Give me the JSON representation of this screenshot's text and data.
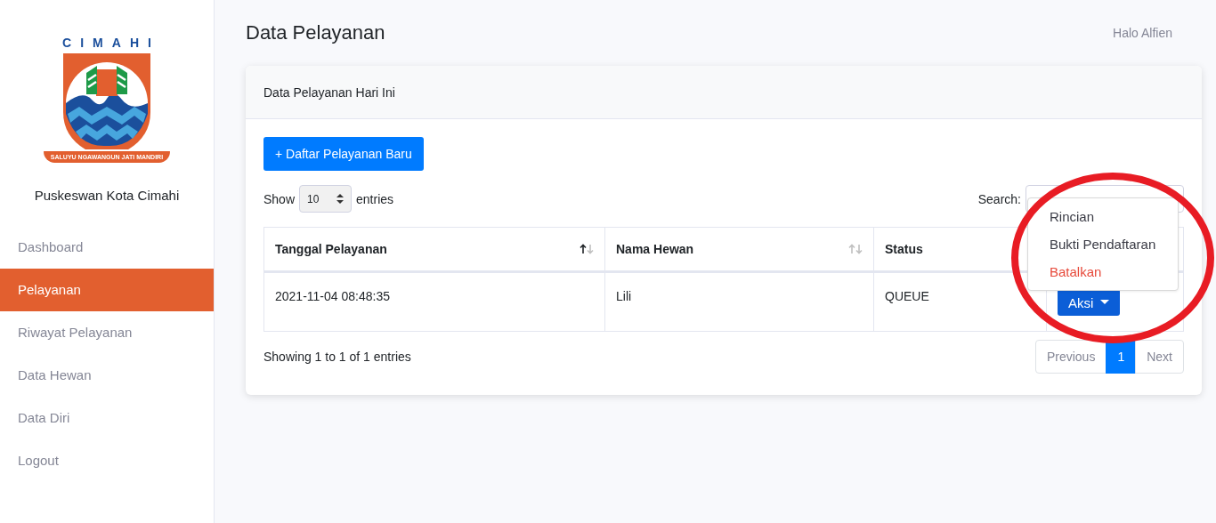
{
  "sidebar": {
    "logo": {
      "city": "CIMAHI",
      "motto": "SALUYU NGAWANGUN JATI MANDIRI"
    },
    "app_name": "Puskeswan Kota Cimahi",
    "items": [
      {
        "label": "Dashboard",
        "selected": false
      },
      {
        "label": "Pelayanan",
        "selected": true
      },
      {
        "label": "Riwayat Pelayanan",
        "selected": false
      },
      {
        "label": "Data Hewan",
        "selected": false
      },
      {
        "label": "Data Diri",
        "selected": false
      },
      {
        "label": "Logout",
        "selected": false
      }
    ]
  },
  "header": {
    "title": "Data Pelayanan",
    "greeting": "Halo Alfien"
  },
  "card": {
    "title": "Data Pelayanan Hari Ini",
    "add_button": "+ Daftar Pelayanan Baru",
    "length": {
      "before": "Show",
      "value": "10",
      "after": "entries"
    },
    "search": {
      "label": "Search:"
    },
    "table": {
      "columns": [
        {
          "label": "Tanggal Pelayanan",
          "sorted": true
        },
        {
          "label": "Nama Hewan",
          "sorted": false
        },
        {
          "label": "Status"
        }
      ],
      "rows": [
        {
          "date": "2021-11-04 08:48:35",
          "animal": "Lili",
          "status": "QUEUE",
          "action": "Aksi"
        }
      ]
    },
    "info": "Showing 1 to 1 of 1 entries",
    "pagination": [
      {
        "label": "Previous",
        "selected": false
      },
      {
        "label": "1",
        "selected": true
      },
      {
        "label": "Next",
        "selected": false
      }
    ],
    "dropdown": {
      "expanded": true,
      "items": [
        {
          "label": "Rincian",
          "kind": "normal"
        },
        {
          "label": "Bukti Pendaftaran",
          "kind": "normal"
        },
        {
          "label": "Batalkan",
          "kind": "danger"
        }
      ]
    }
  },
  "annotation": {
    "kind": "ellipse",
    "color": "#e81c24"
  }
}
